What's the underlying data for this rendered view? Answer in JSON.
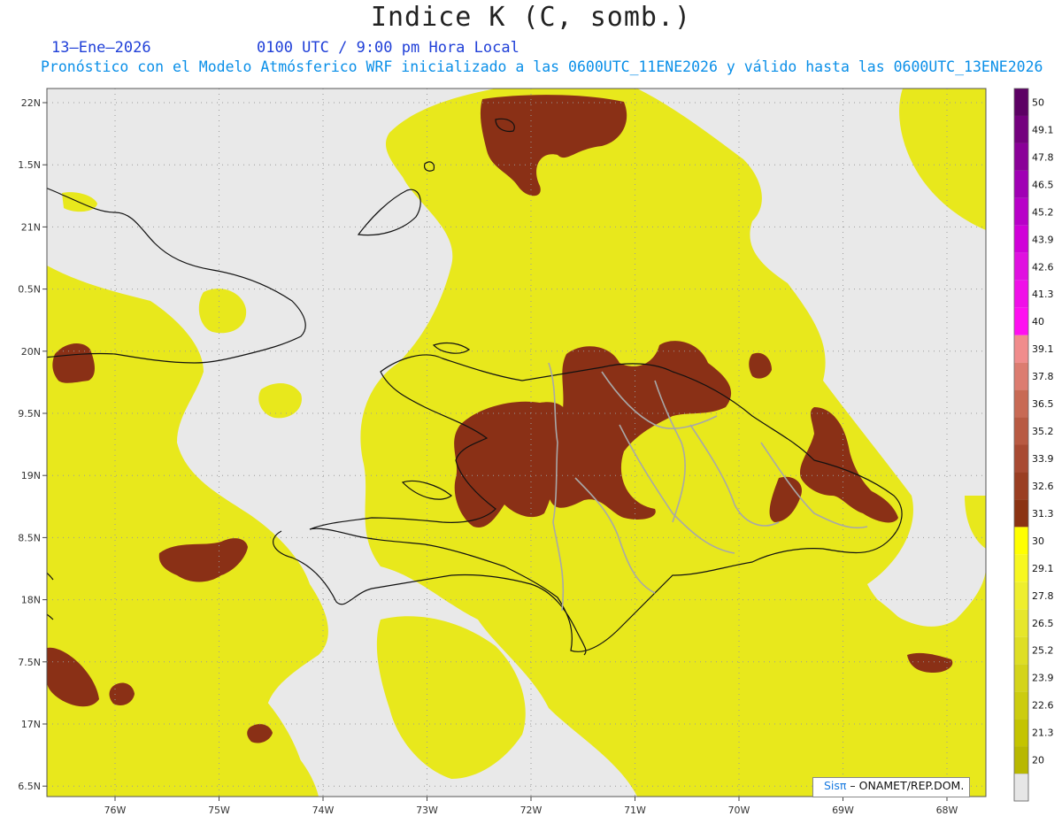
{
  "title": "Indice K (C, somb.)",
  "date": "13–Ene–2026",
  "time": "0100 UTC / 9:00 pm Hora Local",
  "forecast_note": "Pronóstico con el Modelo Atmósferico WRF inicializado a las 0600UTC_11ENE2026 y válido hasta las  0600UTC_13ENE2026",
  "credit": {
    "brand": "Sisπ",
    "org": " – ONAMET/REP.DOM."
  },
  "lat_ticks": [
    "22N",
    "1.5N",
    "21N",
    "0.5N",
    "20N",
    "9.5N",
    "19N",
    "8.5N",
    "18N",
    "7.5N",
    "17N",
    "6.5N"
  ],
  "lon_ticks": [
    "76W",
    "75W",
    "74W",
    "73W",
    "72W",
    "71W",
    "70W",
    "69W",
    "68W"
  ],
  "colorbar": {
    "labels": [
      "20",
      "21.3",
      "22.6",
      "23.9",
      "25.2",
      "26.5",
      "27.8",
      "29.1",
      "30",
      "31.3",
      "32.6",
      "33.9",
      "35.2",
      "36.5",
      "37.8",
      "39.1",
      "40",
      "41.3",
      "42.6",
      "43.9",
      "45.2",
      "46.5",
      "47.8",
      "49.1",
      "50"
    ],
    "colors": [
      "#b8b800",
      "#c4c400",
      "#cccc0e",
      "#d4d41a",
      "#dede24",
      "#e6e62a",
      "#eeee2e",
      "#f7f720",
      "#ffff00",
      "#8b3312",
      "#9a3e22",
      "#a84a32",
      "#b85a42",
      "#c86a54",
      "#dc7c70",
      "#f08c8c",
      "#ff0ff0",
      "#f010e8",
      "#e010e0",
      "#d000d8",
      "#b800c8",
      "#a000b4",
      "#8a0098",
      "#74007e",
      "#5c0064"
    ],
    "missing_color": "#e6e6e6"
  },
  "palette": {
    "land_fill": "#e8e81c",
    "high_fill": "#8a3016",
    "sea_fill": "#e9e9e9",
    "coast_line": "#111111",
    "border_line": "#a8a8a8"
  }
}
